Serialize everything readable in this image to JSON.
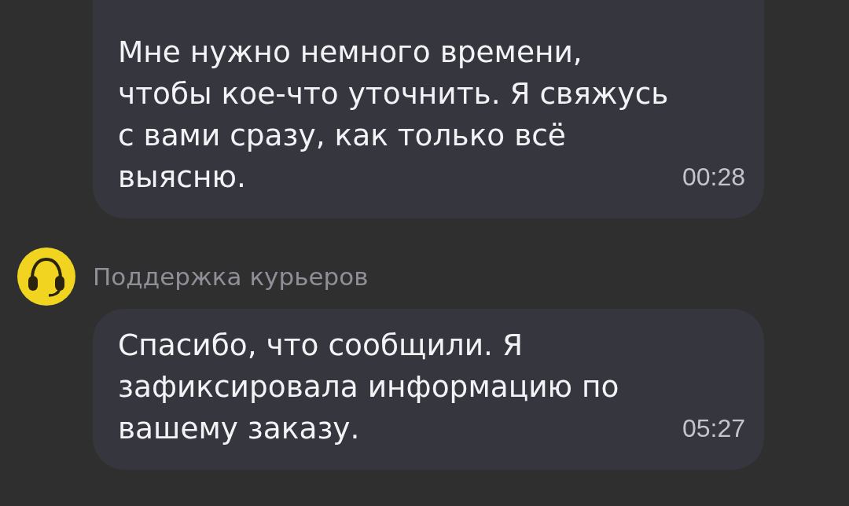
{
  "chat": [
    {
      "kind": "message",
      "text": "Мне нужно немного времени, чтобы кое-что уточнить. Я свяжусь с вами сразу, как только всё выясню.",
      "time": "00:28"
    },
    {
      "kind": "sender",
      "name": "Поддержка курьеров"
    },
    {
      "kind": "message",
      "text": "Спасибо, что сообщили. Я зафиксировала информацию по вашему заказу.",
      "time": "05:27"
    }
  ]
}
